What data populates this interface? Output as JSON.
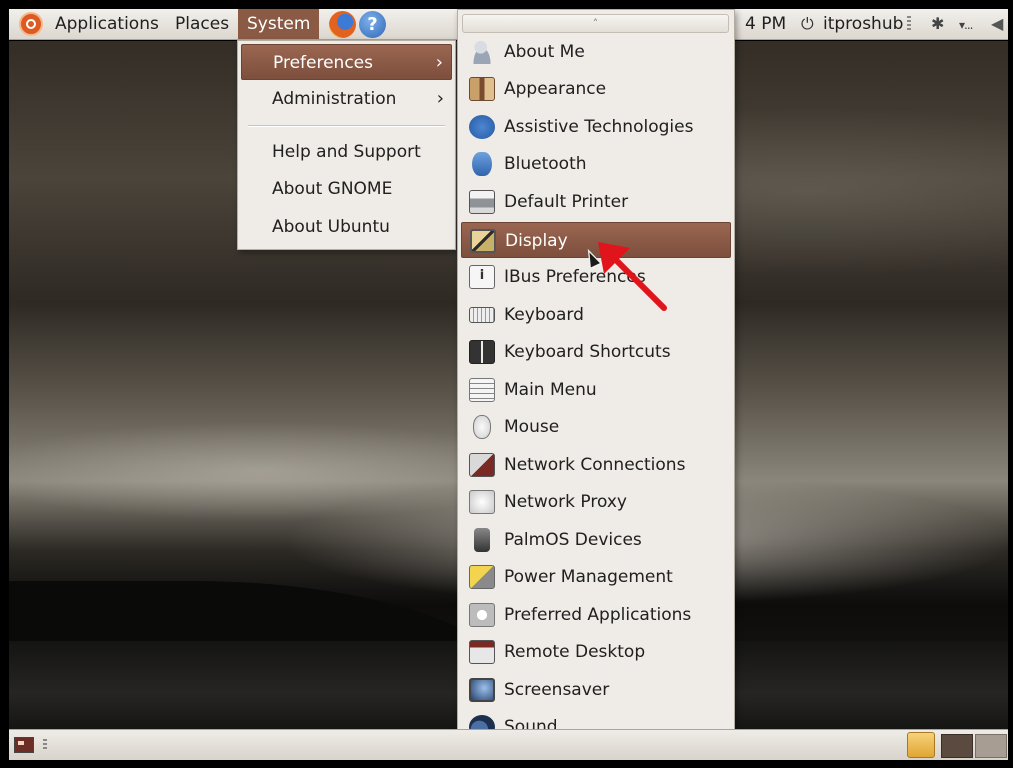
{
  "top_panel": {
    "menus": [
      "Applications",
      "Places",
      "System"
    ],
    "clock": "4 PM",
    "user": "itproshub",
    "icons": [
      "ubuntu-logo-icon",
      "firefox-icon",
      "help-icon",
      "power-icon",
      "bluetooth-icon",
      "network-icon",
      "volume-icon"
    ]
  },
  "system_menu": {
    "items": [
      {
        "label": "Preferences",
        "has_submenu": true,
        "highlighted": true
      },
      {
        "label": "Administration",
        "has_submenu": true
      },
      {
        "label": "Help and Support"
      },
      {
        "label": "About GNOME"
      },
      {
        "label": "About Ubuntu"
      }
    ]
  },
  "preferences_menu": {
    "items": [
      {
        "label": "About Me",
        "icon": "about-me-icon"
      },
      {
        "label": "Appearance",
        "icon": "appearance-icon"
      },
      {
        "label": "Assistive Technologies",
        "icon": "accessibility-icon"
      },
      {
        "label": "Bluetooth",
        "icon": "bluetooth-icon"
      },
      {
        "label": "Default Printer",
        "icon": "printer-icon"
      },
      {
        "label": "Display",
        "icon": "display-icon",
        "highlighted": true
      },
      {
        "label": "IBus Preferences",
        "icon": "ibus-icon"
      },
      {
        "label": "Keyboard",
        "icon": "keyboard-icon"
      },
      {
        "label": "Keyboard Shortcuts",
        "icon": "keyboard-shortcuts-icon"
      },
      {
        "label": "Main Menu",
        "icon": "main-menu-icon"
      },
      {
        "label": "Mouse",
        "icon": "mouse-icon"
      },
      {
        "label": "Network Connections",
        "icon": "network-connections-icon"
      },
      {
        "label": "Network Proxy",
        "icon": "network-proxy-icon"
      },
      {
        "label": "PalmOS Devices",
        "icon": "palm-device-icon"
      },
      {
        "label": "Power Management",
        "icon": "power-management-icon"
      },
      {
        "label": "Preferred Applications",
        "icon": "preferred-apps-icon"
      },
      {
        "label": "Remote Desktop",
        "icon": "remote-desktop-icon"
      },
      {
        "label": "Screensaver",
        "icon": "screensaver-icon"
      },
      {
        "label": "Sound",
        "icon": "sound-icon"
      }
    ]
  },
  "colors": {
    "highlight": "#8a5a44",
    "menu_bg": "#efebe6",
    "annotation_arrow": "#e0141b"
  }
}
